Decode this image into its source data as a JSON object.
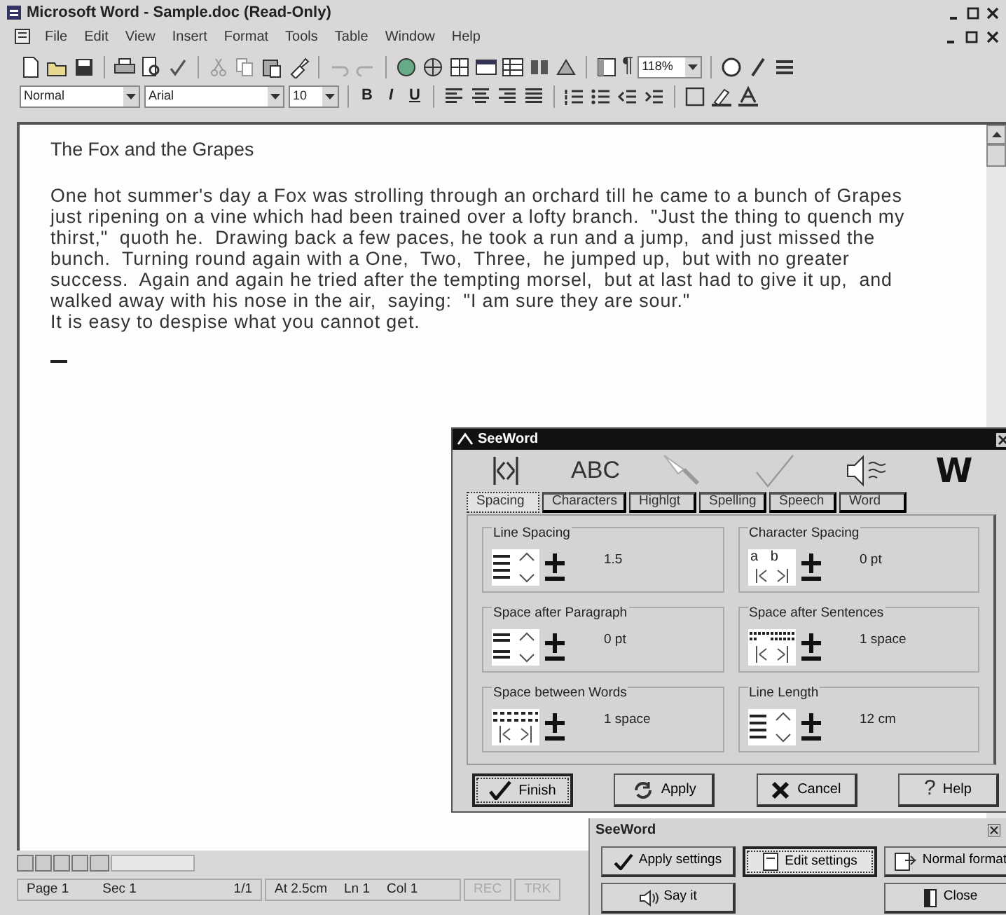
{
  "window": {
    "title": "Microsoft Word - Sample.doc (Read-Only)"
  },
  "menu": [
    "File",
    "Edit",
    "View",
    "Insert",
    "Format",
    "Tools",
    "Table",
    "Window",
    "Help"
  ],
  "toolbar": {
    "pilcrow": "¶",
    "zoom": "118%"
  },
  "formatting": {
    "style": "Normal",
    "font": "Arial",
    "size": "10",
    "bold": "B",
    "italic": "I",
    "underline": "U"
  },
  "document": {
    "title": "The Fox and the Grapes",
    "paragraph_lines": [
      "One hot summer's day a Fox was strolling through an orchard till he came to a bunch of Grapes",
      "just ripening on a vine which had been trained over a lofty branch.  \"Just the thing to quench my",
      "thirst,\"  quoth he.  Drawing back a few paces, he took a run and a jump,  and just missed the",
      "bunch.  Turning round again with a One,  Two,  Three,  he jumped up,  but with no greater",
      "success.  Again and again he tried after the tempting morsel,  but at last had to give it up,  and",
      "walked away with his nose in the air,  saying:  \"I am sure they are sour.\""
    ],
    "moral": "It is easy to despise what you cannot get."
  },
  "status_bar": {
    "page": "Page 1",
    "section": "Sec 1",
    "pages": "1/1",
    "at": "At 2.5cm",
    "line": "Ln 1",
    "column": "Col 1",
    "modes": [
      {
        "label": "REC",
        "disabled": true
      },
      {
        "label": "TRK",
        "disabled": true
      }
    ]
  },
  "seeword_dialog": {
    "title": "SeeWord",
    "icons": [
      {
        "kind": "spacing"
      },
      {
        "kind": "text",
        "text": "ABC"
      },
      {
        "kind": "highlighter"
      },
      {
        "kind": "check"
      },
      {
        "kind": "speaker"
      },
      {
        "kind": "text",
        "text": "W"
      }
    ],
    "tabs": [
      {
        "label": "Spacing",
        "selected": true
      },
      {
        "label": "Characters",
        "selected": false
      },
      {
        "label": "Highlgt",
        "selected": false
      },
      {
        "label": "Spelling",
        "selected": false
      },
      {
        "label": "Speech",
        "selected": false
      },
      {
        "label": "Word",
        "selected": false
      }
    ],
    "groups": [
      {
        "label": "Line Spacing",
        "kind": "lines",
        "value": "1.5"
      },
      {
        "label": "Character Spacing",
        "kind": "letters",
        "icon_text": "a b",
        "value": "0 pt"
      },
      {
        "label": "Space after Paragraph",
        "kind": "paragraph",
        "value": "0 pt"
      },
      {
        "label": "Space after Sentences",
        "kind": "dots",
        "value": "1 space"
      },
      {
        "label": "Space between Words",
        "kind": "words",
        "value": "1 space"
      },
      {
        "label": "Line Length",
        "kind": "lines",
        "value": "12 cm"
      }
    ],
    "buttons": [
      {
        "label": "Finish",
        "kind": "check",
        "default": true
      },
      {
        "label": "Apply",
        "kind": "refresh",
        "default": false
      },
      {
        "label": "Cancel",
        "kind": "cross",
        "default": false
      },
      {
        "label": "Help",
        "kind": "glyph",
        "glyph": "?",
        "default": false
      }
    ]
  },
  "seeword_toolbar": {
    "title": "SeeWord",
    "buttons": [
      {
        "label": "Apply settings",
        "kind": "check",
        "pressed": false
      },
      {
        "label": "Edit settings",
        "kind": "edit",
        "pressed": true
      },
      {
        "label": "Normal format",
        "kind": "format",
        "pressed": false
      },
      {
        "label": "Say it",
        "kind": "speaker",
        "pressed": false
      },
      {
        "label": "Close",
        "kind": "door",
        "pressed": false
      }
    ]
  }
}
